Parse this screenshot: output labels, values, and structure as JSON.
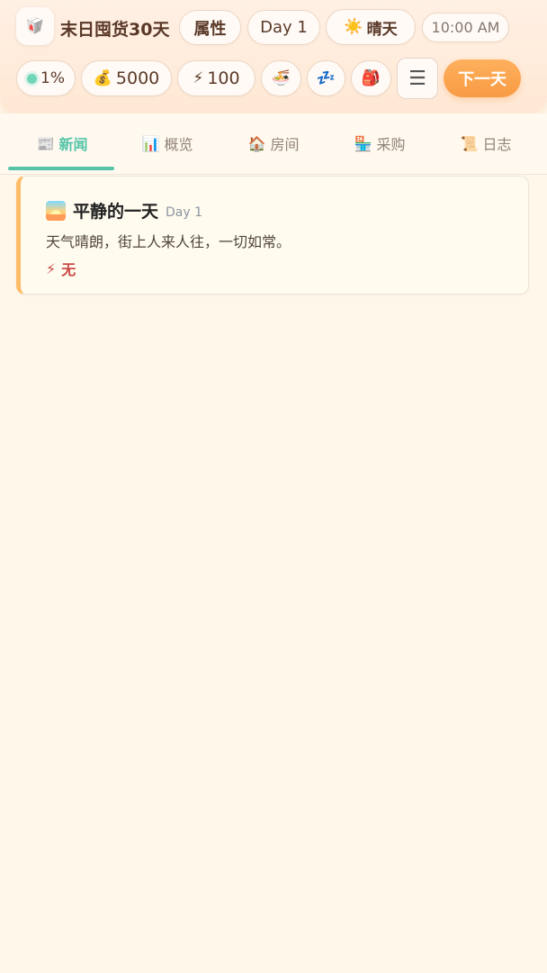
{
  "header": {
    "title": "末日囤货30天",
    "attributes_label": "属性",
    "day_label": "Day 1",
    "weather_label": "晴天",
    "time_label": "10:00 AM",
    "progress_label": "1%",
    "money_label": "5000",
    "energy_label": "100",
    "next_day_label": "下一天"
  },
  "icons": {
    "logo": "🥡",
    "weather": "☀️",
    "money": "💰",
    "energy": "⚡",
    "food": "🍜",
    "sleep": "💤",
    "bag": "🎒",
    "menu": "☰",
    "tab_news": "📰",
    "tab_overview": "📊",
    "tab_room": "🏠",
    "tab_purchase": "🏪",
    "tab_log": "📜",
    "impact": "⚡"
  },
  "tabs": [
    {
      "label": "新闻",
      "active": true
    },
    {
      "label": "概览",
      "active": false
    },
    {
      "label": "房间",
      "active": false
    },
    {
      "label": "采购",
      "active": false
    },
    {
      "label": "日志",
      "active": false
    }
  ],
  "news": {
    "title": "平静的一天",
    "day": "Day 1",
    "body": "天气晴朗，街上人来人往，一切如常。",
    "impact": "无"
  },
  "colors": {
    "accent_green": "#55c4a8",
    "accent_orange": "#f79b43",
    "background": "#fff7ea"
  }
}
